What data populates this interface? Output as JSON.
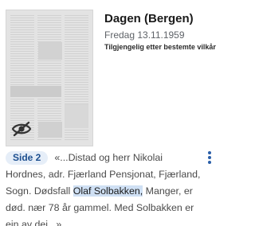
{
  "newspaper": {
    "title": "Dagen (Bergen)",
    "date": "Fredag 13.11.1959",
    "access_notice": "Tilgjengelig etter bestemte vilkår"
  },
  "result": {
    "page_badge": "Side 2",
    "snippet_before": "«...Distad og herr Nikolai Hordnes, adr. Fjærland Pensjonat, Fjærland, Sogn. Dødsfall ",
    "snippet_highlight": "Olaf Solbakken,",
    "snippet_after": " Manger, er død. nær 78 år gammel. Med Solbakken er ein av dei...»"
  },
  "icons": {
    "thumbnail_overlay": "eye-off-icon",
    "menu": "more-vert-icon"
  },
  "colors": {
    "badge_bg": "#e6eef8",
    "badge_text": "#1d4f8f",
    "highlight": "#cfe0f4",
    "menu_dots": "#2a5ea8"
  }
}
